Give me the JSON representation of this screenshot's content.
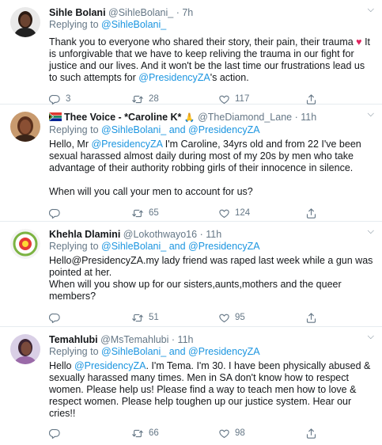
{
  "tweets": [
    {
      "name": "Sihle Bolani",
      "handle": "@SihleBolani_",
      "time": "7h",
      "reply_label": "Replying to",
      "reply_to": "@SihleBolani_",
      "text_1": "Thank you to everyone who shared their story, their pain, their trauma",
      "text_emoji": "♥",
      "text_2": " It is unforgivable that we have to keep reliving the trauma in our fight for justice and our lives. And it won't be the last time our frustrations lead us to such attempts for ",
      "text_mention": "@PresidencyZA",
      "text_3": "'s action.",
      "replies": "3",
      "retweets": "28",
      "likes": "117"
    },
    {
      "name": "Thee Voice - *Caroline K*",
      "name_emoji": "🙏",
      "handle": "@TheDiamond_Lane",
      "time": "11h",
      "reply_label": "Replying to",
      "reply_to_1": "@SihleBolani_",
      "reply_and": "and",
      "reply_to_2": "@PresidencyZA",
      "text_1a": "Hello, Mr ",
      "text_mention": "@PresidencyZA",
      "text_1b": " I'm Caroline, 34yrs old and from 22 I've been sexual harassed almost daily during most of my 20s by men who take advantage of their authority robbing girls of their innocence in silence.",
      "text_2": "When will you call your men to account for us?",
      "retweets": "65",
      "likes": "124"
    },
    {
      "name": "Khehla Dlamini",
      "handle": "@Lokothwayo16",
      "time": "11h",
      "reply_label": "Replying to",
      "reply_to_1": "@SihleBolani_",
      "reply_and": "and",
      "reply_to_2": "@PresidencyZA",
      "text_1": "Hello@PresidencyZA.my lady friend was raped last week while a gun was pointed at her.",
      "text_2": "When will you show up for our sisters,aunts,mothers and the queer members?",
      "retweets": "51",
      "likes": "95"
    },
    {
      "name": "Temahlubi",
      "handle": "@MsTemahlubi",
      "time": "11h",
      "reply_label": "Replying to",
      "reply_to_1": "@SihleBolani_",
      "reply_and": "and",
      "reply_to_2": "@PresidencyZA",
      "text_a": "Hello ",
      "text_mention": "@PresidencyZA",
      "text_b": ". I'm Tema. I'm 30. I have been physically abused & sexually harassed many times. Men in SA don't know how to respect women. Please help us! Please find a way to teach men how to love & respect women. Please help toughen up our justice system. Hear our cries!!",
      "retweets": "66",
      "likes": "98"
    }
  ],
  "separator": "·",
  "colors": {
    "link": "#1b95e0",
    "muted": "#657786",
    "heart": "#e0245e",
    "border": "#e6ecf0"
  },
  "icons": [
    "reply-icon",
    "retweet-icon",
    "like-icon",
    "share-icon",
    "caret-down-icon",
    "south-africa-flag-icon"
  ]
}
